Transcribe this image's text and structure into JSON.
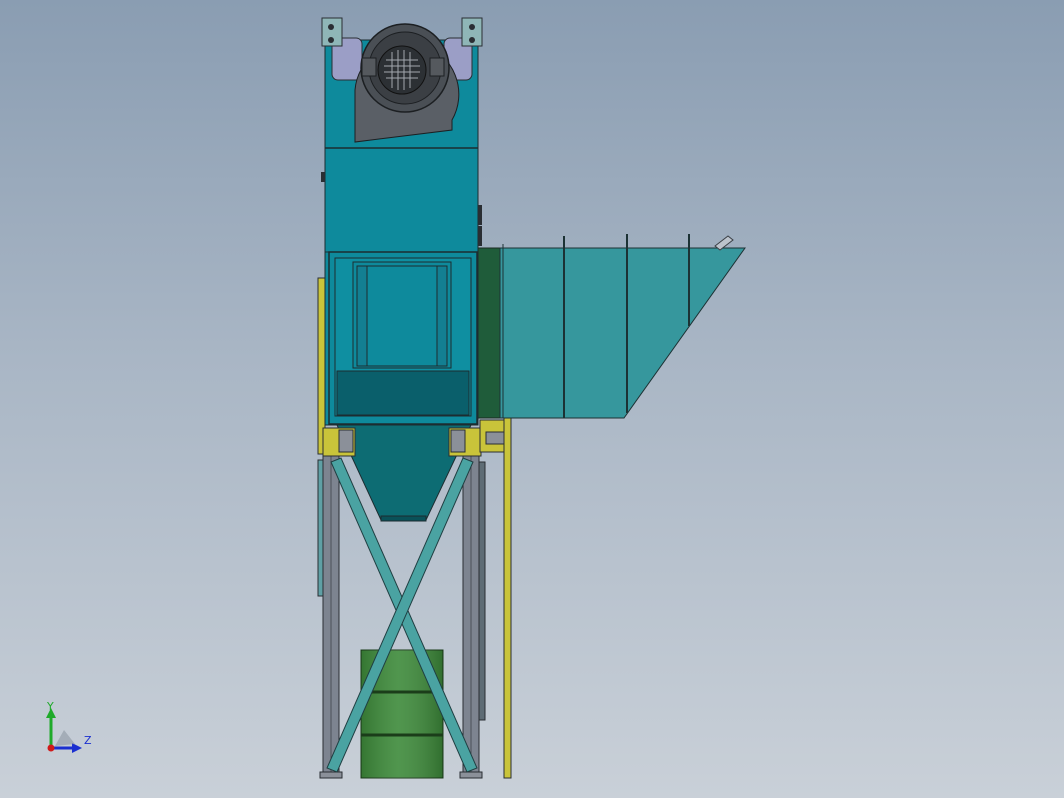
{
  "viewport": {
    "background_top": "#8a9db2",
    "background_bottom": "#c9d0d8"
  },
  "model": {
    "colors": {
      "housing": "#0e8a9c",
      "housing_dark": "#0a6e7c",
      "inlet_duct": "#36979d",
      "hopper": "#0d6c73",
      "blower_housing": "#5a5f66",
      "motor": "#3b3f44",
      "frame_legs": "#7d8490",
      "cross_brace": "#4aa3a2",
      "yellow_parts": "#c9c43a",
      "drum": "#3d8a3a",
      "flange_green": "#1f5c3a"
    }
  },
  "triad": {
    "y_label": "Y",
    "z_label": "Z",
    "y_color": "#1faa2a",
    "z_color": "#1a2fd0",
    "origin_color": "#d01a1a"
  }
}
